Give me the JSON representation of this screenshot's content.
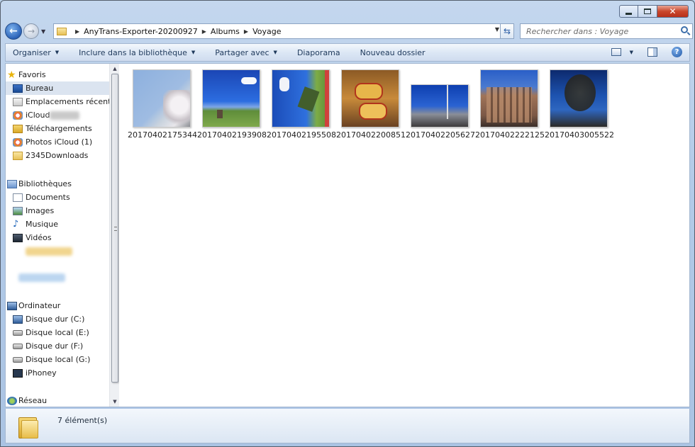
{
  "window": {
    "controls": {
      "minimize": "minimize",
      "maximize": "maximize",
      "close": "close"
    }
  },
  "address": {
    "crumbs": [
      "AnyTrans-Exporter-20200927",
      "Albums",
      "Voyage"
    ]
  },
  "search": {
    "placeholder": "Rechercher dans : Voyage"
  },
  "toolbar": {
    "organize": "Organiser",
    "include": "Inclure dans la bibliothèque",
    "share": "Partager avec",
    "slideshow": "Diaporama",
    "new_folder": "Nouveau dossier"
  },
  "nav": {
    "favorites": {
      "title": "Favoris",
      "items": [
        "Bureau",
        "Emplacements récents",
        "iCloud",
        "Téléchargements",
        "Photos iCloud (1)",
        "2345Downloads"
      ]
    },
    "libraries": {
      "title": "Bibliothèques",
      "items": [
        "Documents",
        "Images",
        "Musique",
        "Vidéos"
      ]
    },
    "computer": {
      "title": "Ordinateur",
      "items": [
        "Disque dur (C:)",
        "Disque local (E:)",
        "Disque dur (F:)",
        "Disque local (G:)",
        "iPhoney"
      ]
    },
    "network": {
      "title": "Réseau"
    }
  },
  "files": [
    {
      "name": "20170402175344",
      "theme": "sky-blossom"
    },
    {
      "name": "20170402193908",
      "theme": "windmill-field"
    },
    {
      "name": "20170402195508",
      "theme": "windmill-rotated"
    },
    {
      "name": "20170402200851",
      "theme": "wooden-shoes"
    },
    {
      "name": "20170402205627",
      "theme": "city-square"
    },
    {
      "name": "20170402222125",
      "theme": "building-facade"
    },
    {
      "name": "20170403005522",
      "theme": "tree-sky"
    }
  ],
  "status": {
    "count": "7 élément(s)"
  }
}
